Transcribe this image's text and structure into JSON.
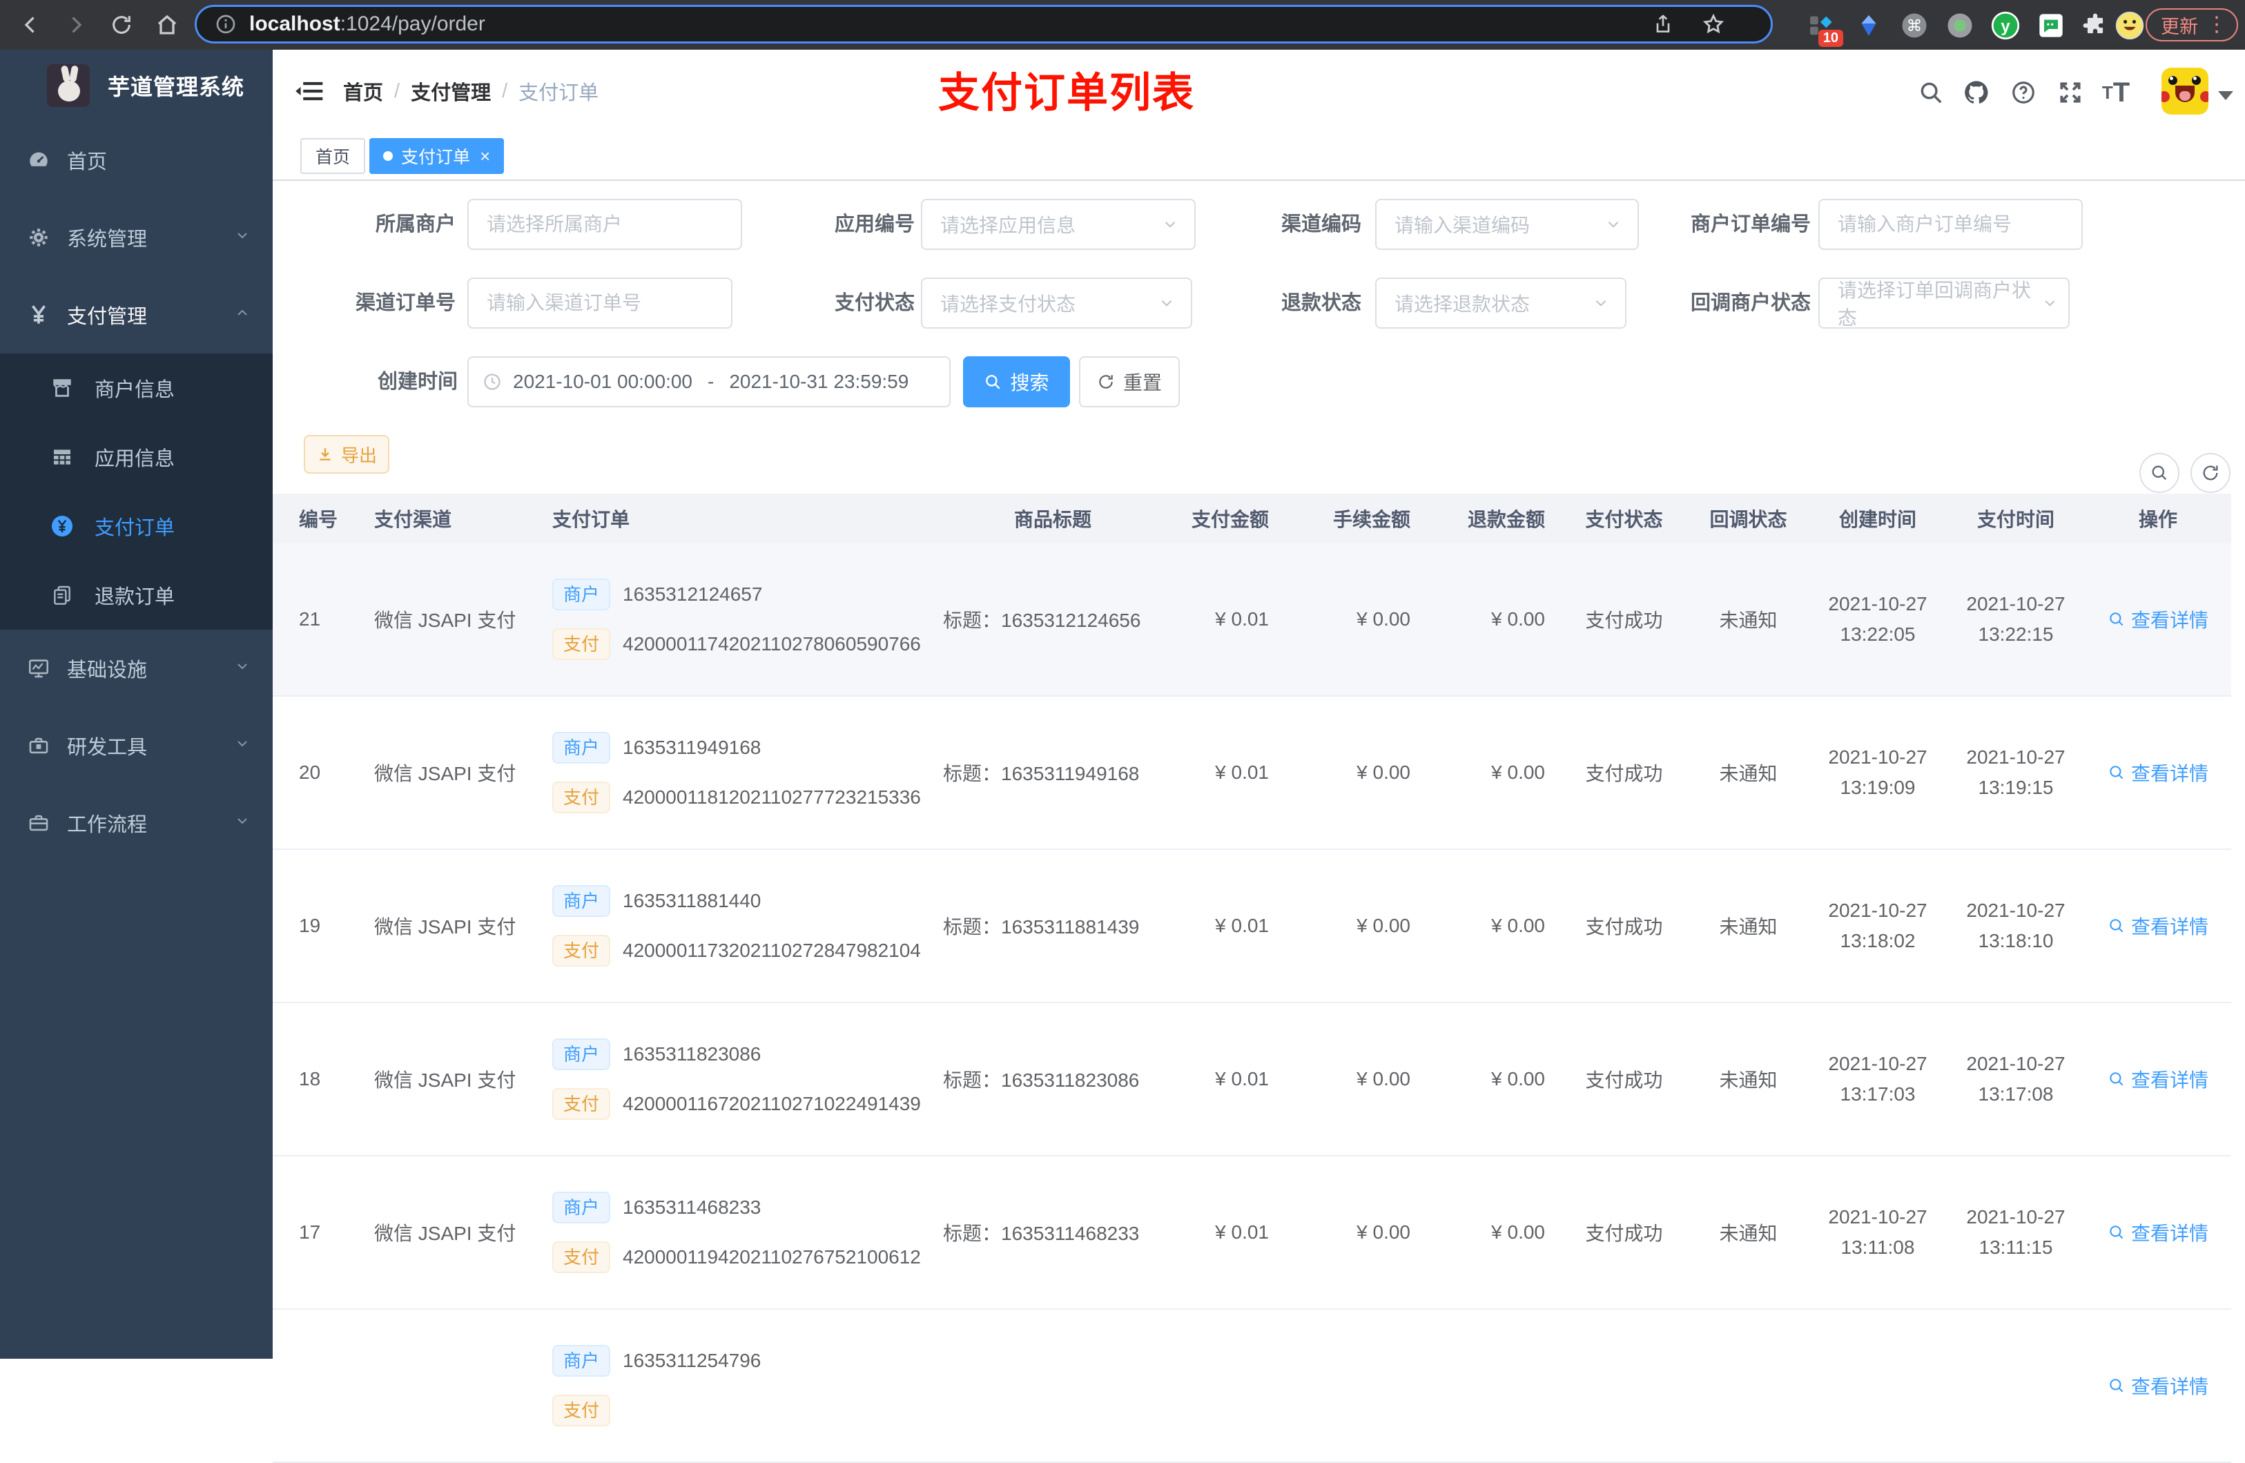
{
  "colors": {
    "accent": "#409eff",
    "warning": "#e6a23c",
    "annotation_red": "#fe1300",
    "sidebar_bg": "#304156",
    "submenu_bg": "#1f2d3d",
    "tag_blue_bg": "#ecf5ff",
    "tag_yellow_bg": "#fdf6ec"
  },
  "browser": {
    "url_host": "localhost",
    "url_rest": ":1024/pay/order",
    "extension_badge": "10",
    "update_label": "更新"
  },
  "sidebar": {
    "title": "芋道管理系统",
    "items": [
      {
        "label": "首页"
      },
      {
        "label": "系统管理"
      },
      {
        "label": "支付管理"
      },
      {
        "label": "商户信息"
      },
      {
        "label": "应用信息"
      },
      {
        "label": "支付订单"
      },
      {
        "label": "退款订单"
      },
      {
        "label": "基础设施"
      },
      {
        "label": "研发工具"
      },
      {
        "label": "工作流程"
      }
    ]
  },
  "navbar": {
    "breadcrumb": [
      "首页",
      "支付管理",
      "支付订单"
    ],
    "annotation": "支付订单列表"
  },
  "tags_bar": {
    "tabs": [
      {
        "label": "首页",
        "active": false
      },
      {
        "label": "支付订单",
        "active": true
      }
    ],
    "close_glyph": "×"
  },
  "filters": {
    "merchant": {
      "label": "所属商户",
      "placeholder": "请选择所属商户"
    },
    "app": {
      "label": "应用编号",
      "placeholder": "请选择应用信息"
    },
    "channel_code": {
      "label": "渠道编码",
      "placeholder": "请输入渠道编码"
    },
    "merchant_order_no": {
      "label": "商户订单编号",
      "placeholder": "请输入商户订单编号"
    },
    "channel_order_no": {
      "label": "渠道订单号",
      "placeholder": "请输入渠道订单号"
    },
    "pay_status": {
      "label": "支付状态",
      "placeholder": "请选择支付状态"
    },
    "refund_status": {
      "label": "退款状态",
      "placeholder": "请选择退款状态"
    },
    "notify_status": {
      "label": "回调商户状态",
      "placeholder": "请选择订单回调商户状态"
    },
    "create_time": {
      "label": "创建时间",
      "start": "2021-10-01 00:00:00",
      "separator": "-",
      "end": "2021-10-31 23:59:59"
    }
  },
  "actions": {
    "search": "搜索",
    "reset": "重置",
    "export": "导出"
  },
  "table": {
    "columns": [
      "编号",
      "支付渠道",
      "支付订单",
      "商品标题",
      "支付金额",
      "手续金额",
      "退款金额",
      "支付状态",
      "回调状态",
      "创建时间",
      "支付时间",
      "操作"
    ],
    "merchant_tag": "商户",
    "pay_tag": "支付",
    "action_label": "查看详情",
    "rows": [
      {
        "id": "21",
        "channel": "微信 JSAPI 支付",
        "merchant_no": "1635312124657",
        "pay_no": "4200001174202110278060590766",
        "title": "标题：1635312124656",
        "amount": "¥ 0.01",
        "fee": "¥ 0.00",
        "refund": "¥ 0.00",
        "pay_status": "支付成功",
        "notify_status": "未通知",
        "create_date": "2021-10-27",
        "create_time": "13:22:05",
        "pay_date": "2021-10-27",
        "pay_time": "13:22:15"
      },
      {
        "id": "20",
        "channel": "微信 JSAPI 支付",
        "merchant_no": "1635311949168",
        "pay_no": "4200001181202110277723215336",
        "title": "标题：1635311949168",
        "amount": "¥ 0.01",
        "fee": "¥ 0.00",
        "refund": "¥ 0.00",
        "pay_status": "支付成功",
        "notify_status": "未通知",
        "create_date": "2021-10-27",
        "create_time": "13:19:09",
        "pay_date": "2021-10-27",
        "pay_time": "13:19:15"
      },
      {
        "id": "19",
        "channel": "微信 JSAPI 支付",
        "merchant_no": "1635311881440",
        "pay_no": "4200001173202110272847982104",
        "title": "标题：1635311881439",
        "amount": "¥ 0.01",
        "fee": "¥ 0.00",
        "refund": "¥ 0.00",
        "pay_status": "支付成功",
        "notify_status": "未通知",
        "create_date": "2021-10-27",
        "create_time": "13:18:02",
        "pay_date": "2021-10-27",
        "pay_time": "13:18:10"
      },
      {
        "id": "18",
        "channel": "微信 JSAPI 支付",
        "merchant_no": "1635311823086",
        "pay_no": "4200001167202110271022491439",
        "title": "标题：1635311823086",
        "amount": "¥ 0.01",
        "fee": "¥ 0.00",
        "refund": "¥ 0.00",
        "pay_status": "支付成功",
        "notify_status": "未通知",
        "create_date": "2021-10-27",
        "create_time": "13:17:03",
        "pay_date": "2021-10-27",
        "pay_time": "13:17:08"
      },
      {
        "id": "17",
        "channel": "微信 JSAPI 支付",
        "merchant_no": "1635311468233",
        "pay_no": "4200001194202110276752100612",
        "title": "标题：1635311468233",
        "amount": "¥ 0.01",
        "fee": "¥ 0.00",
        "refund": "¥ 0.00",
        "pay_status": "支付成功",
        "notify_status": "未通知",
        "create_date": "2021-10-27",
        "create_time": "13:11:08",
        "pay_date": "2021-10-27",
        "pay_time": "13:11:15"
      },
      {
        "id": "",
        "channel": "",
        "merchant_no": "1635311254796",
        "pay_no": "",
        "title": "",
        "amount": "",
        "fee": "",
        "refund": "",
        "pay_status": "",
        "notify_status": "",
        "create_date": "",
        "create_time": "",
        "pay_date": "",
        "pay_time": ""
      }
    ]
  }
}
